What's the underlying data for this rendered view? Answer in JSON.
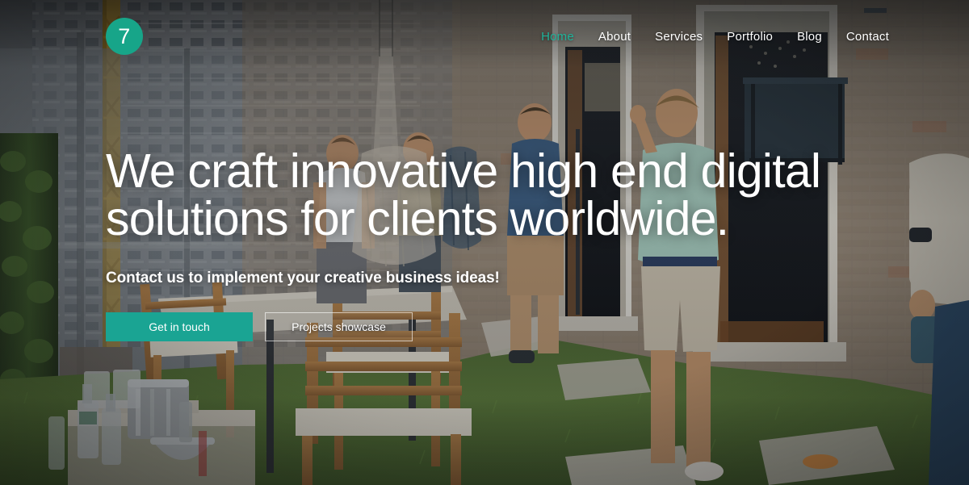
{
  "site": {
    "logo": {
      "text": "7",
      "icon": "circle-badge-icon",
      "color": "#17a589"
    }
  },
  "nav": {
    "items": [
      {
        "label": "Home",
        "active": true
      },
      {
        "label": "About",
        "active": false
      },
      {
        "label": "Services",
        "active": false
      },
      {
        "label": "Portfolio",
        "active": false
      },
      {
        "label": "Blog",
        "active": false
      },
      {
        "label": "Contact",
        "active": false
      }
    ],
    "active_color": "#1fb39a",
    "color": "#ffffff"
  },
  "hero": {
    "headline_line1": "We craft innovative high end digital",
    "headline_line2": "solutions for clients worldwide.",
    "subheadline": "Contact us to implement your creative business ideas!",
    "primary_button": {
      "label": "Get in touch",
      "background": "#1aa493",
      "color": "#ffffff"
    },
    "secondary_button": {
      "label": "Projects showcase",
      "border_color": "rgba(255,255,255,0.62)",
      "color": "#ffffff"
    },
    "background": {
      "description": "rooftop terrace at dusk with artificial grass, wooden patio furniture, bar cart with glassware, brick wall with open doorways, people playing cornhole, city high-rise and construction crane in background",
      "overlay_color": "rgba(18,20,22,0.30)"
    }
  }
}
